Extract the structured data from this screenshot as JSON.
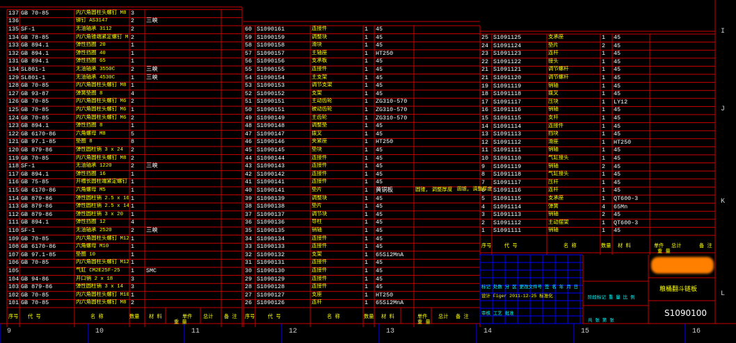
{
  "colors": {
    "frame": "#cc0000",
    "text_white": "#ffffff",
    "text_yellow": "#ffff00",
    "title_blue": "#0000ff"
  },
  "table_left": {
    "rows": [
      [
        "137",
        "GB 70-85",
        "内六角圆柱头螺钉 M8 x 35",
        "3",
        ""
      ],
      [
        "136",
        "",
        "铆钉 AS3147",
        "2",
        "三峡"
      ],
      [
        "135",
        "SF-1",
        "无油轴承 3112",
        "2",
        ""
      ],
      [
        "134",
        "GB 78-85",
        "内六角锥端紧定螺钉 M6 x 10",
        "2",
        ""
      ],
      [
        "133",
        "GB 894.1",
        "弹性挡圈 20",
        "1",
        ""
      ],
      [
        "132",
        "GB 894.1",
        "弹性挡圈 40",
        "1",
        ""
      ],
      [
        "131",
        "GB 894.1",
        "弹性挡圈 65",
        "1",
        ""
      ],
      [
        "134",
        "SL801-1",
        "无油轴承 3550C",
        "2",
        "三峡"
      ],
      [
        "129",
        "SL801-1",
        "无油轴承 4530C",
        "1",
        "三峡"
      ],
      [
        "128",
        "GB 70-85",
        "内六角圆柱头螺钉 M8 x 45",
        "1",
        ""
      ],
      [
        "127",
        "GB 93-87",
        "弹簧垫圈 8",
        "4",
        ""
      ],
      [
        "126",
        "GB 70-85",
        "内六角圆柱头螺钉 M6 x 20",
        "2",
        ""
      ],
      [
        "125",
        "GB 70-85",
        "内六角圆柱头螺钉 M6 x 12",
        "1",
        ""
      ],
      [
        "124",
        "GB 70-85",
        "内六角圆柱头螺钉 M6 x 16",
        "2",
        ""
      ],
      [
        "123",
        "GB 894.1",
        "弹性挡圈 8",
        "1",
        ""
      ],
      [
        "122",
        "GB 6170-86",
        "六角螺母 M8",
        "5",
        ""
      ],
      [
        "121",
        "GB 97.1-85",
        "垫圈 8",
        "8",
        ""
      ],
      [
        "120",
        "GB 879-86",
        "弹性圆柱销 3 x 24",
        "2",
        ""
      ],
      [
        "119",
        "GB 70-85",
        "内六角圆柱头螺钉 M8 x 50",
        "2",
        ""
      ],
      [
        "118",
        "SF-1",
        "无油轴承 1220",
        "2",
        "三峡"
      ],
      [
        "117",
        "GB 894.1",
        "弹性挡圈 16",
        "1",
        ""
      ],
      [
        "116",
        "GB 75-85",
        "开槽长圆柱端紧定螺钉 M5 x 14",
        "1",
        ""
      ],
      [
        "115",
        "GB 6170-86",
        "六角螺母 M5",
        "1",
        ""
      ],
      [
        "114",
        "GB 879-86",
        "弹性圆柱销 2.5 x 16",
        "1",
        ""
      ],
      [
        "113",
        "GB 879-86",
        "弹性圆柱销 2.5 x 14",
        "1",
        ""
      ],
      [
        "112",
        "GB 879-86",
        "弹性圆柱销 3 x 20",
        "1",
        ""
      ],
      [
        "111",
        "GB 894.1",
        "弹性挡圈 12",
        "4",
        ""
      ],
      [
        "110",
        "SF-1",
        "无油轴承 2520",
        "2",
        "三峡"
      ],
      [
        "109",
        "GB 70-85",
        "内六角圆柱头螺钉 M12 x 35",
        "1",
        ""
      ],
      [
        "108",
        "GB 6170-86",
        "六角螺母 M10",
        "1",
        ""
      ],
      [
        "107",
        "GB 97.1-85",
        "垫圈 10",
        "1",
        ""
      ],
      [
        "106",
        "GB 70-85",
        "内六角圆柱头螺钉 M12 x 45",
        "1",
        ""
      ],
      [
        "105",
        "",
        "气缸 CM2E25F-25",
        "1",
        "SMC"
      ],
      [
        "104",
        "GB 94-86",
        "开口销 2 x 18",
        "3",
        ""
      ],
      [
        "103",
        "GB 879-86",
        "弹性圆柱销 3 x 14",
        "3",
        ""
      ],
      [
        "102",
        "GB 70-85",
        "内六角圆柱头螺钉 M10 x 55",
        "1",
        ""
      ],
      [
        "101",
        "GB 70-85",
        "内六角圆柱头螺钉 M8 x 20",
        "2",
        ""
      ]
    ]
  },
  "table_middle": {
    "rows": [
      [
        "60",
        "S1090161",
        "连接件",
        "1",
        "45",
        ""
      ],
      [
        "59",
        "S1090159",
        "调整块",
        "1",
        "45",
        ""
      ],
      [
        "58",
        "S1090158",
        "滑块",
        "1",
        "45",
        ""
      ],
      [
        "57",
        "S1090157",
        "主轴座",
        "1",
        "HT250",
        ""
      ],
      [
        "56",
        "S1090156",
        "支承板",
        "1",
        "45",
        ""
      ],
      [
        "55",
        "S1090155",
        "连接件",
        "1",
        "45",
        ""
      ],
      [
        "54",
        "S1090154",
        "主支架",
        "1",
        "45",
        ""
      ],
      [
        "53",
        "S1090153",
        "调节支架",
        "1",
        "45",
        ""
      ],
      [
        "52",
        "S1090152",
        "支架",
        "1",
        "45",
        ""
      ],
      [
        "51",
        "S1090151",
        "主动齿轮",
        "1",
        "ZG310-570",
        ""
      ],
      [
        "50",
        "S1090151",
        "被动齿轮",
        "1",
        "ZG310-570",
        ""
      ],
      [
        "49",
        "S1090149",
        "主齿轮",
        "1",
        "ZG310-570",
        ""
      ],
      [
        "48",
        "S1090148",
        "调整垫",
        "1",
        "45",
        ""
      ],
      [
        "47",
        "S1090147",
        "拨叉",
        "1",
        "45",
        ""
      ],
      [
        "46",
        "S1090146",
        "夹紧座",
        "1",
        "HT250",
        ""
      ],
      [
        "45",
        "S1090145",
        "垫块",
        "1",
        "45",
        ""
      ],
      [
        "44",
        "S1090144",
        "连接件",
        "1",
        "45",
        ""
      ],
      [
        "43",
        "S1090143",
        "连接件",
        "1",
        "45",
        ""
      ],
      [
        "42",
        "S1090142",
        "连接件",
        "1",
        "45",
        ""
      ],
      [
        "41",
        "S1090141",
        "连接件",
        "1",
        "45",
        ""
      ],
      [
        "40",
        "S1090141",
        "垫片",
        "1",
        "黄铜板",
        "圆锥, 调整厚度"
      ],
      [
        "39",
        "S1090139",
        "调整块",
        "1",
        "45",
        ""
      ],
      [
        "38",
        "S1090138",
        "垫片",
        "1",
        "45",
        ""
      ],
      [
        "37",
        "S1090137",
        "调节块",
        "1",
        "45",
        ""
      ],
      [
        "36",
        "S1090136",
        "导柱",
        "1",
        "45",
        ""
      ],
      [
        "35",
        "S1090135",
        "销轴",
        "1",
        "45",
        ""
      ],
      [
        "34",
        "S1090134",
        "连接件",
        "1",
        "45",
        ""
      ],
      [
        "33",
        "S1090133",
        "连接件",
        "1",
        "45",
        ""
      ],
      [
        "32",
        "S1090132",
        "支架",
        "1",
        "65Si2MnA",
        ""
      ],
      [
        "31",
        "S1090131",
        "连接件",
        "1",
        "45",
        ""
      ],
      [
        "30",
        "S1090130",
        "连接件",
        "1",
        "45",
        ""
      ],
      [
        "29",
        "S1090129",
        "连接件",
        "1",
        "45",
        ""
      ],
      [
        "28",
        "S1090128",
        "连接件",
        "1",
        "45",
        ""
      ],
      [
        "27",
        "S1090127",
        "支座",
        "1",
        "HT250",
        ""
      ],
      [
        "26",
        "S1090126",
        "连杆",
        "1",
        "65Si2MnA",
        ""
      ]
    ]
  },
  "table_right": {
    "rows": [
      [
        "25",
        "S1091125",
        "支承座",
        "1",
        "45"
      ],
      [
        "24",
        "S1091124",
        "垫片",
        "2",
        "45"
      ],
      [
        "23",
        "S1091123",
        "连杆",
        "1",
        "45"
      ],
      [
        "22",
        "S1091122",
        "接头",
        "1",
        "45"
      ],
      [
        "21",
        "S1091121",
        "调节螺杆",
        "1",
        "45"
      ],
      [
        "21",
        "S1091120",
        "调节螺杆",
        "1",
        "45"
      ],
      [
        "19",
        "S1091119",
        "销轴",
        "1",
        "45"
      ],
      [
        "18",
        "S1091118",
        "拨叉",
        "1",
        "45"
      ],
      [
        "17",
        "S1091117",
        "压块",
        "1",
        "LY12"
      ],
      [
        "16",
        "S1091116",
        "销轴",
        "1",
        "45"
      ],
      [
        "15",
        "S1091115",
        "支杆",
        "1",
        "45"
      ],
      [
        "14",
        "S1091114",
        "连接件",
        "1",
        "45"
      ],
      [
        "13",
        "S1091113",
        "挡块",
        "1",
        "45"
      ],
      [
        "12",
        "S1091112",
        "滑座",
        "1",
        "HT250"
      ],
      [
        "11",
        "S1091111",
        "销轴",
        "1",
        "45"
      ],
      [
        "10",
        "S1091110",
        "气缸接头",
        "1",
        "45"
      ],
      [
        "9",
        "S1091119",
        "销轴",
        "2",
        "45"
      ],
      [
        "8",
        "S1091118",
        "气缸接头",
        "1",
        "45"
      ],
      [
        "7",
        "S1091117",
        "压杆",
        "1",
        "45"
      ],
      [
        "6",
        "S1091116",
        "连杆",
        "1",
        "45"
      ],
      [
        "5",
        "S1091115",
        "支承座",
        "1",
        "QT600-3"
      ],
      [
        "4",
        "S1091114",
        "弹簧",
        "4",
        "65Mn"
      ],
      [
        "3",
        "S1091113",
        "销轴",
        "2",
        "45"
      ],
      [
        "2",
        "S1091112",
        "主动摆架",
        "1",
        "QT600-3"
      ],
      [
        "1",
        "S1091111",
        "销轴",
        "1",
        "45"
      ]
    ]
  },
  "headers": {
    "seq": "序号",
    "code": "代 号",
    "name": "名 称",
    "qty": "数量",
    "material": "材 料",
    "unit_weight": "单件",
    "total_weight": "总计",
    "weight": "重 量",
    "remark": "备 注"
  },
  "title_block": {
    "drawing_title": "粮桶翻斗链板",
    "drawing_number": "S1090100",
    "cells_row1": "标记 处数 分 区 更改文件号 签 名 年 月 日",
    "designer_row": "设计 Figer 2011-12-25 标准化",
    "cells_mid": "阶段标记  重 量  比 例",
    "cells_bottom": "共   张  第   张",
    "cells_bottom_left": "审核    工艺    批准",
    "remark_label": "圆锥, 调整厚度"
  },
  "border": {
    "bottom_numbers": [
      "9",
      "10",
      "11",
      "12",
      "13",
      "14",
      "15",
      "16"
    ],
    "right_letters": [
      "I",
      "J",
      "K",
      "L"
    ]
  }
}
